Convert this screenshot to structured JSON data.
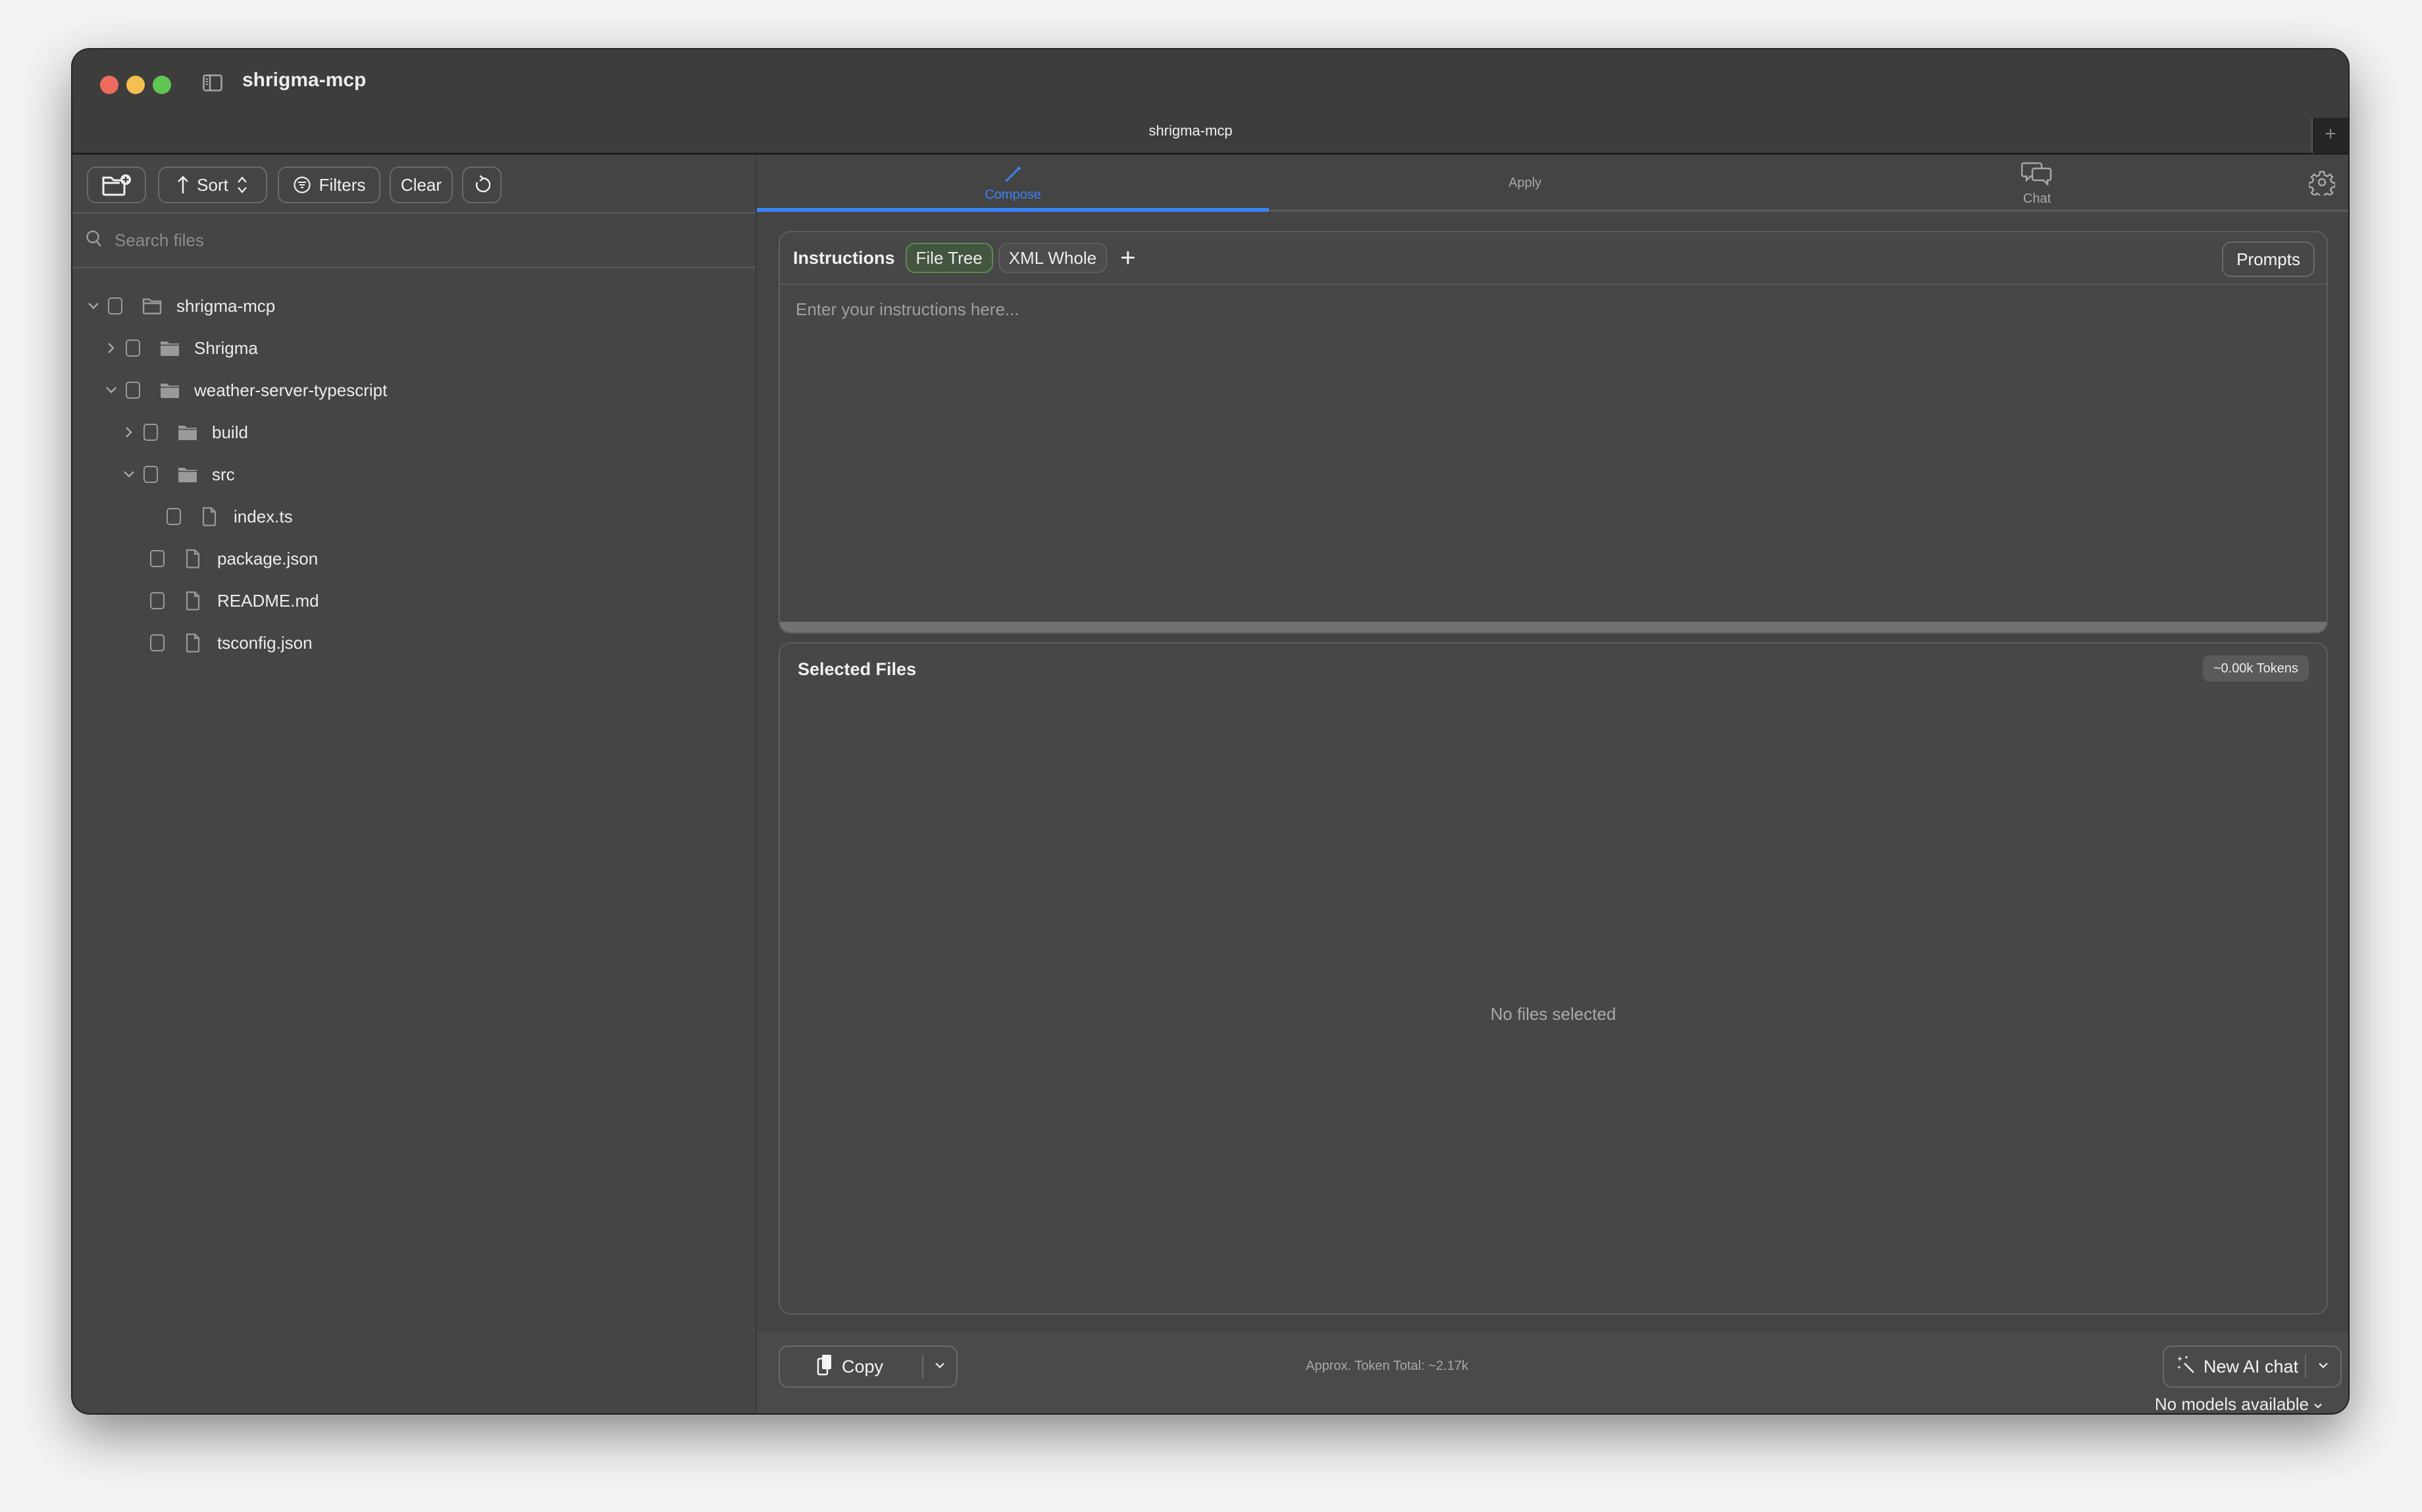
{
  "window": {
    "title": "shrigma-mcp",
    "tab_title": "shrigma-mcp",
    "new_tab_label": "+"
  },
  "sidebar": {
    "toolbar": {
      "sort_label": "Sort",
      "filters_label": "Filters",
      "clear_label": "Clear"
    },
    "search": {
      "placeholder": "Search files",
      "value": ""
    },
    "tree": [
      {
        "name": "shrigma-mcp",
        "type": "folder-root",
        "expanded": true,
        "depth": 0,
        "checked": false
      },
      {
        "name": "Shrigma",
        "type": "folder",
        "expanded": false,
        "depth": 1,
        "checked": false
      },
      {
        "name": "weather-server-typescript",
        "type": "folder",
        "expanded": true,
        "depth": 1,
        "checked": false
      },
      {
        "name": "build",
        "type": "folder",
        "expanded": false,
        "depth": 2,
        "checked": false
      },
      {
        "name": "src",
        "type": "folder",
        "expanded": true,
        "depth": 2,
        "checked": false
      },
      {
        "name": "index.ts",
        "type": "file",
        "depth": 3,
        "checked": false
      },
      {
        "name": "package.json",
        "type": "file",
        "depth": 2,
        "checked": false
      },
      {
        "name": "README.md",
        "type": "file",
        "depth": 2,
        "checked": false
      },
      {
        "name": "tsconfig.json",
        "type": "file",
        "depth": 2,
        "checked": false
      }
    ]
  },
  "main": {
    "tabs": [
      {
        "label": "Compose",
        "icon": "pencil-icon",
        "active": true
      },
      {
        "label": "Apply",
        "icon": "",
        "active": false
      },
      {
        "label": "Chat",
        "icon": "chat-bubbles-icon",
        "active": false
      }
    ],
    "accent_color": "#3b82f6",
    "instructions": {
      "title": "Instructions",
      "chips": [
        {
          "label": "File Tree",
          "active": true
        },
        {
          "label": "XML Whole",
          "active": false
        }
      ],
      "add_label": "+",
      "prompts_label": "Prompts",
      "placeholder": "Enter your instructions here...",
      "value": ""
    },
    "selected_files": {
      "title": "Selected Files",
      "token_badge": "~0.00k Tokens",
      "empty_message": "No files selected"
    },
    "bottom": {
      "copy_label": "Copy",
      "token_total": "Approx. Token Total: ~2.17k",
      "new_chat_label": "New AI chat",
      "toggle_on": false,
      "models_label": "No models available"
    }
  }
}
